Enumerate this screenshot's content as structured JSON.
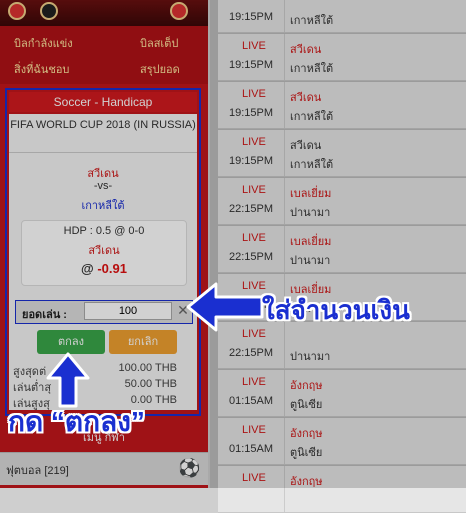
{
  "menu": {
    "items": [
      "บิลกำลังแข่ง",
      "บิลสเต็ป",
      "สิ่งที่ฉันชอบ",
      "สรุปยอด"
    ]
  },
  "slip": {
    "header": "Soccer - Handicap",
    "match_title": "FIFA WORLD CUP 2018 (IN RUSSIA)",
    "team_home": "สวีเดน",
    "versus": "-vs-",
    "team_away": "เกาหลีใต้",
    "hdp_line": "HDP : 0.5 @ 0-0",
    "pick": "สวีเดน",
    "odds_at": "@",
    "odds_value": "-0.91",
    "stake_label": "ยอดเล่น :",
    "stake_value": "100",
    "clear_symbol": "✕",
    "confirm_label": "ตกลง",
    "cancel_label": "ยกเลิก",
    "limits": [
      {
        "label": "สูงสุดต่",
        "value": "100.00 THB"
      },
      {
        "label": "เล่นต่ำสุ",
        "value": "50.00 THB"
      },
      {
        "label": "เล่นสูงสุ",
        "value": "0.00 THB"
      }
    ]
  },
  "sports_menu": {
    "title": "เมนู กีฬา",
    "item_label": "ฟุตบอล [219]",
    "icon": "soccer-ball-icon"
  },
  "matches": [
    {
      "status": "",
      "time": "19:15PM",
      "team_a": "",
      "team_b": "เกาหลีใต้"
    },
    {
      "status": "LIVE",
      "time": "19:15PM",
      "team_a": "สวีเดน",
      "team_b": "เกาหลีใต้"
    },
    {
      "status": "LIVE",
      "time": "19:15PM",
      "team_a": "สวีเดน",
      "team_b": "เกาหลีใต้"
    },
    {
      "status": "LIVE",
      "time": "19:15PM",
      "team_a": "สวีเดน",
      "team_b": "เกาหลีใต้"
    },
    {
      "status": "LIVE",
      "time": "22:15PM",
      "team_a": "เบลเยี่ยม",
      "team_b": "ปานามา"
    },
    {
      "status": "LIVE",
      "time": "22:15PM",
      "team_a": "เบลเยี่ยม",
      "team_b": "ปานามา"
    },
    {
      "status": "LIVE",
      "time": "22:15PM",
      "team_a": "เบลเยี่ยม",
      "team_b": "ปานามา"
    },
    {
      "status": "LIVE",
      "time": "22:15PM",
      "team_a": "",
      "team_b": "ปานามา"
    },
    {
      "status": "LIVE",
      "time": "01:15AM",
      "team_a": "อังกฤษ",
      "team_b": "ตูนิเซีย"
    },
    {
      "status": "LIVE",
      "time": "01:15AM",
      "team_a": "อังกฤษ",
      "team_b": "ตูนิเซีย"
    },
    {
      "status": "LIVE",
      "time": "",
      "team_a": "อังกฤษ",
      "team_b": ""
    }
  ],
  "annotations": {
    "enter_amount": "ใส่จำนวนเงิน",
    "press_ok": "กด “ตกลง”"
  },
  "colors": {
    "brand_red": "#c2161b",
    "live_red": "#d01818",
    "highlight_blue": "#1a2fd0",
    "confirm_green": "#3aa64a",
    "cancel_orange": "#f0a030",
    "odds_red": "#e01010"
  }
}
